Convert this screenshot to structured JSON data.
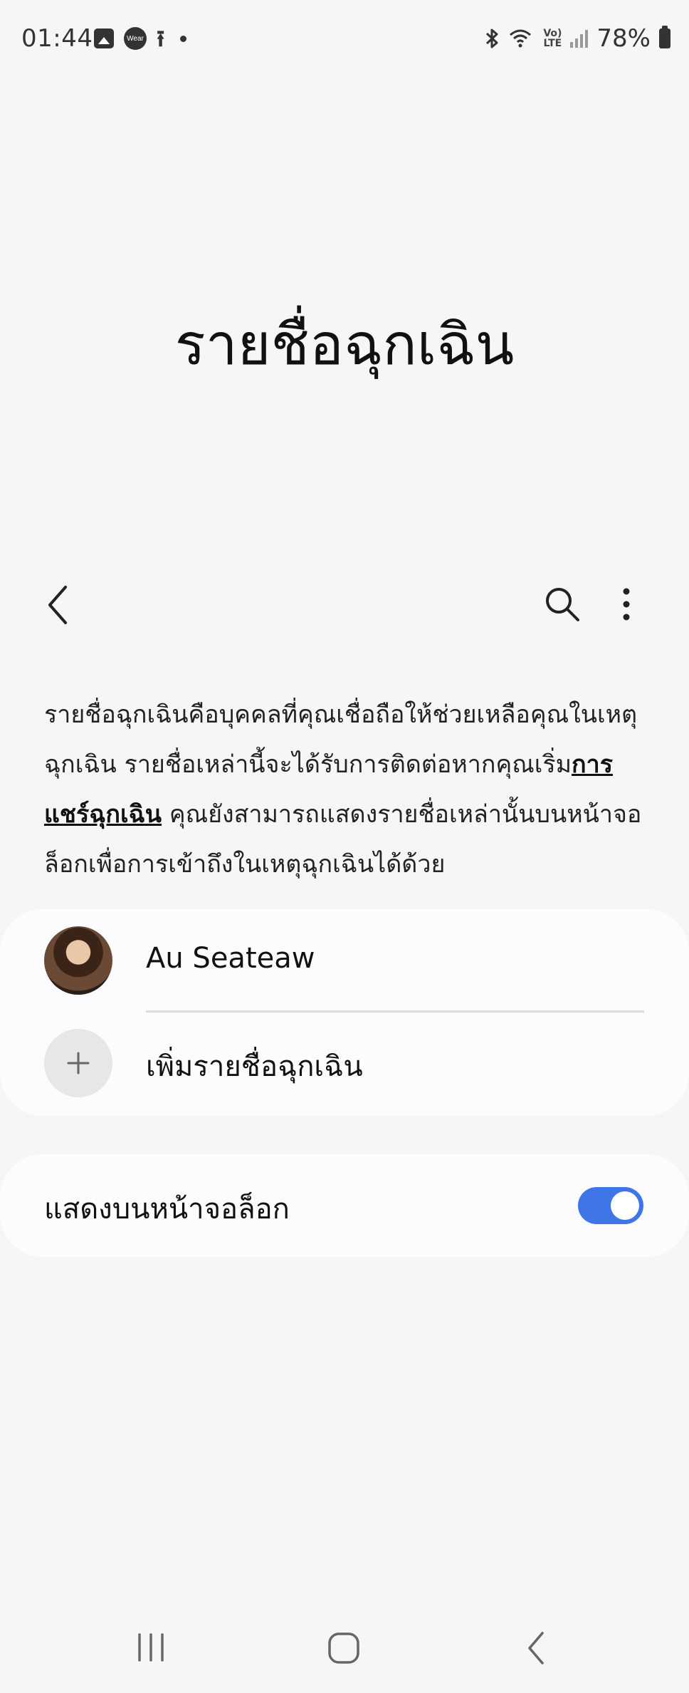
{
  "status_bar": {
    "time": "01:44",
    "left_icons": [
      "gallery-icon",
      "wear-icon",
      "upload-icon",
      "dot-icon"
    ],
    "wear_label": "Wear",
    "right_icons": [
      "bluetooth-icon",
      "wifi-icon",
      "volte-icon",
      "signal-icon",
      "battery-icon"
    ],
    "volte_top": "Vo)",
    "volte_bottom": "LTE",
    "battery": "78%"
  },
  "page": {
    "title": "รายชื่อฉุกเฉิน"
  },
  "toolbar": {
    "icons": [
      "back-icon",
      "search-icon",
      "more-icon"
    ]
  },
  "description": {
    "part1": "รายชื่อฉุกเฉินคือบุคคลที่คุณเชื่อถือให้ช่วยเหลือคุณในเหตุฉุกเฉิน รายชื่อเหล่านี้จะได้รับการติดต่อหากคุณเริ่ม",
    "link": "การแชร์ฉุกเฉิน",
    "part2": " คุณยังสามารถแสดงรายชื่อเหล่านั้นบนหน้าจอล็อกเพื่อการเข้าถึงในเหตุฉุกเฉินได้ด้วย"
  },
  "contacts": [
    {
      "name": "Au Seateaw"
    }
  ],
  "add_contact": {
    "label": "เพิ่มรายชื่อฉุกเฉิน"
  },
  "lock_screen": {
    "label": "แสดงบนหน้าจอล็อก",
    "enabled": true
  },
  "nav_bar": {
    "icons": [
      "recents-icon",
      "home-icon",
      "back-icon"
    ]
  },
  "colors": {
    "background": "#f6f6f8",
    "card": "#fcfcfe",
    "accent": "#3e76e8"
  }
}
